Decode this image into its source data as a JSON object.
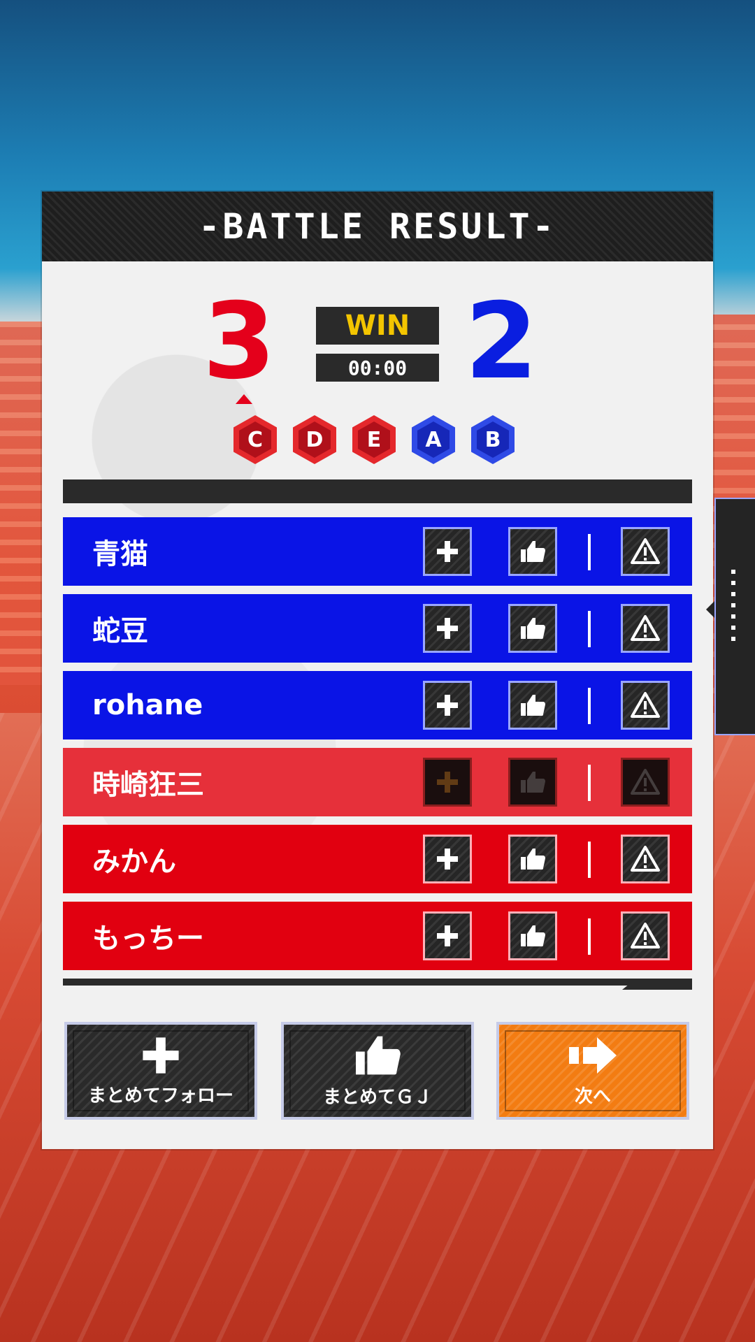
{
  "header": {
    "title": "-BATTLE RESULT-"
  },
  "score": {
    "red": "3",
    "blue": "2",
    "result": "WIN",
    "time": "00:00"
  },
  "ranks": [
    {
      "letter": "C",
      "team": "red"
    },
    {
      "letter": "D",
      "team": "red"
    },
    {
      "letter": "E",
      "team": "red"
    },
    {
      "letter": "A",
      "team": "blue"
    },
    {
      "letter": "B",
      "team": "blue"
    }
  ],
  "players": [
    {
      "name": "青猫",
      "team": "blue"
    },
    {
      "name": "蛇豆",
      "team": "blue"
    },
    {
      "name": "rohane",
      "team": "blue"
    },
    {
      "name": "時崎狂三",
      "team": "red",
      "self": true
    },
    {
      "name": "みかん",
      "team": "red"
    },
    {
      "name": "もっちー",
      "team": "red"
    }
  ],
  "footer": {
    "follow_all": "まとめてフォロー",
    "gj_all": "まとめてＧＪ",
    "next": "次へ"
  },
  "colors": {
    "red_team": "#e10010",
    "blue_team": "#0a14e6",
    "win": "#f3c500",
    "next_button": "#f37c12"
  },
  "icons": {
    "follow": "plus-icon",
    "gj": "thumbs-up-icon",
    "report": "warning-icon",
    "next": "arrow-right-icon",
    "drawer": "dots-vertical-icon"
  }
}
